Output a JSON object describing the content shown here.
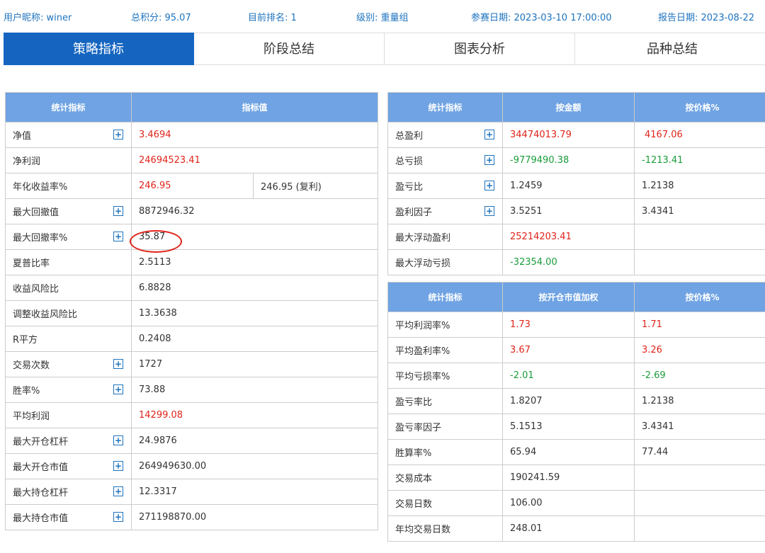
{
  "header": {
    "nickname": "用户昵称: winer",
    "score": "总积分: 95.07",
    "rank": "目前排名: 1",
    "level": "级别: 重量组",
    "join_date": "参赛日期: 2023-03-10 17:00:00",
    "report_date": "报告日期: 2023-08-22"
  },
  "tabs": [
    "策略指标",
    "阶段总结",
    "图表分析",
    "品种总结"
  ],
  "left_table": {
    "headers": [
      "统计指标",
      "指标值"
    ],
    "rows": [
      {
        "label": "净值",
        "value": "3.4694",
        "extra": ""
      },
      {
        "label": "净利润",
        "value": "24694523.41",
        "extra": ""
      },
      {
        "label": "年化收益率%",
        "value": "246.95",
        "extra": "246.95 (复利)"
      },
      {
        "label": "最大回撤值",
        "value": "8872946.32",
        "extra": ""
      },
      {
        "label": "最大回撤率%",
        "value": "35.87",
        "extra": ""
      },
      {
        "label": "夏普比率",
        "value": "2.5113",
        "extra": ""
      },
      {
        "label": "收益风险比",
        "value": "6.8828",
        "extra": ""
      },
      {
        "label": "调整收益风险比",
        "value": "13.3638",
        "extra": ""
      },
      {
        "label": "R平方",
        "value": "0.2408",
        "extra": ""
      },
      {
        "label": "交易次数",
        "value": "1727",
        "extra": ""
      },
      {
        "label": "胜率%",
        "value": "73.88",
        "extra": ""
      },
      {
        "label": "平均利润",
        "value": "14299.08",
        "extra": ""
      },
      {
        "label": "最大开仓杠杆",
        "value": "24.9876",
        "extra": ""
      },
      {
        "label": "最大开仓市值",
        "value": "264949630.00",
        "extra": ""
      },
      {
        "label": "最大持仓杠杆",
        "value": "12.3317",
        "extra": ""
      },
      {
        "label": "最大持仓市值",
        "value": "271198870.00",
        "extra": ""
      }
    ]
  },
  "right_table1": {
    "headers": [
      "统计指标",
      "按金额",
      "按价格%"
    ],
    "rows": [
      {
        "label": "总盈利",
        "amount": "34474013.79",
        "pct": "4167.06"
      },
      {
        "label": "总亏损",
        "amount": "-9779490.38",
        "pct": "-1213.41"
      },
      {
        "label": "盈亏比",
        "amount": "1.2459",
        "pct": "1.2138"
      },
      {
        "label": "盈利因子",
        "amount": "3.5251",
        "pct": "3.4341"
      },
      {
        "label": "最大浮动盈利",
        "amount": "25214203.41",
        "pct": ""
      },
      {
        "label": "最大浮动亏损",
        "amount": "-32354.00",
        "pct": ""
      }
    ]
  },
  "right_table2": {
    "headers": [
      "统计指标",
      "按开仓市值加权",
      "按价格%"
    ],
    "rows": [
      {
        "label": "平均利润率%",
        "a": "1.73",
        "b": "1.71"
      },
      {
        "label": "平均盈利率%",
        "a": "3.67",
        "b": "3.26"
      },
      {
        "label": "平均亏损率%",
        "a": "-2.01",
        "b": "-2.69"
      },
      {
        "label": "盈亏率比",
        "a": "1.8207",
        "b": "1.2138"
      },
      {
        "label": "盈亏率因子",
        "a": "5.1513",
        "b": "3.4341"
      },
      {
        "label": "胜算率%",
        "a": "65.94",
        "b": "77.44"
      },
      {
        "label": "交易成本",
        "a": "190241.59",
        "b": ""
      },
      {
        "label": "交易日数",
        "a": "106.00",
        "b": ""
      },
      {
        "label": "年均交易日数",
        "a": "248.01",
        "b": ""
      }
    ]
  },
  "expand_symbol": "+",
  "colors": {
    "accent": "#1565c0",
    "header_bg": "#6fa3e3",
    "positive": "#e0241a",
    "negative": "#1a9c3a"
  }
}
